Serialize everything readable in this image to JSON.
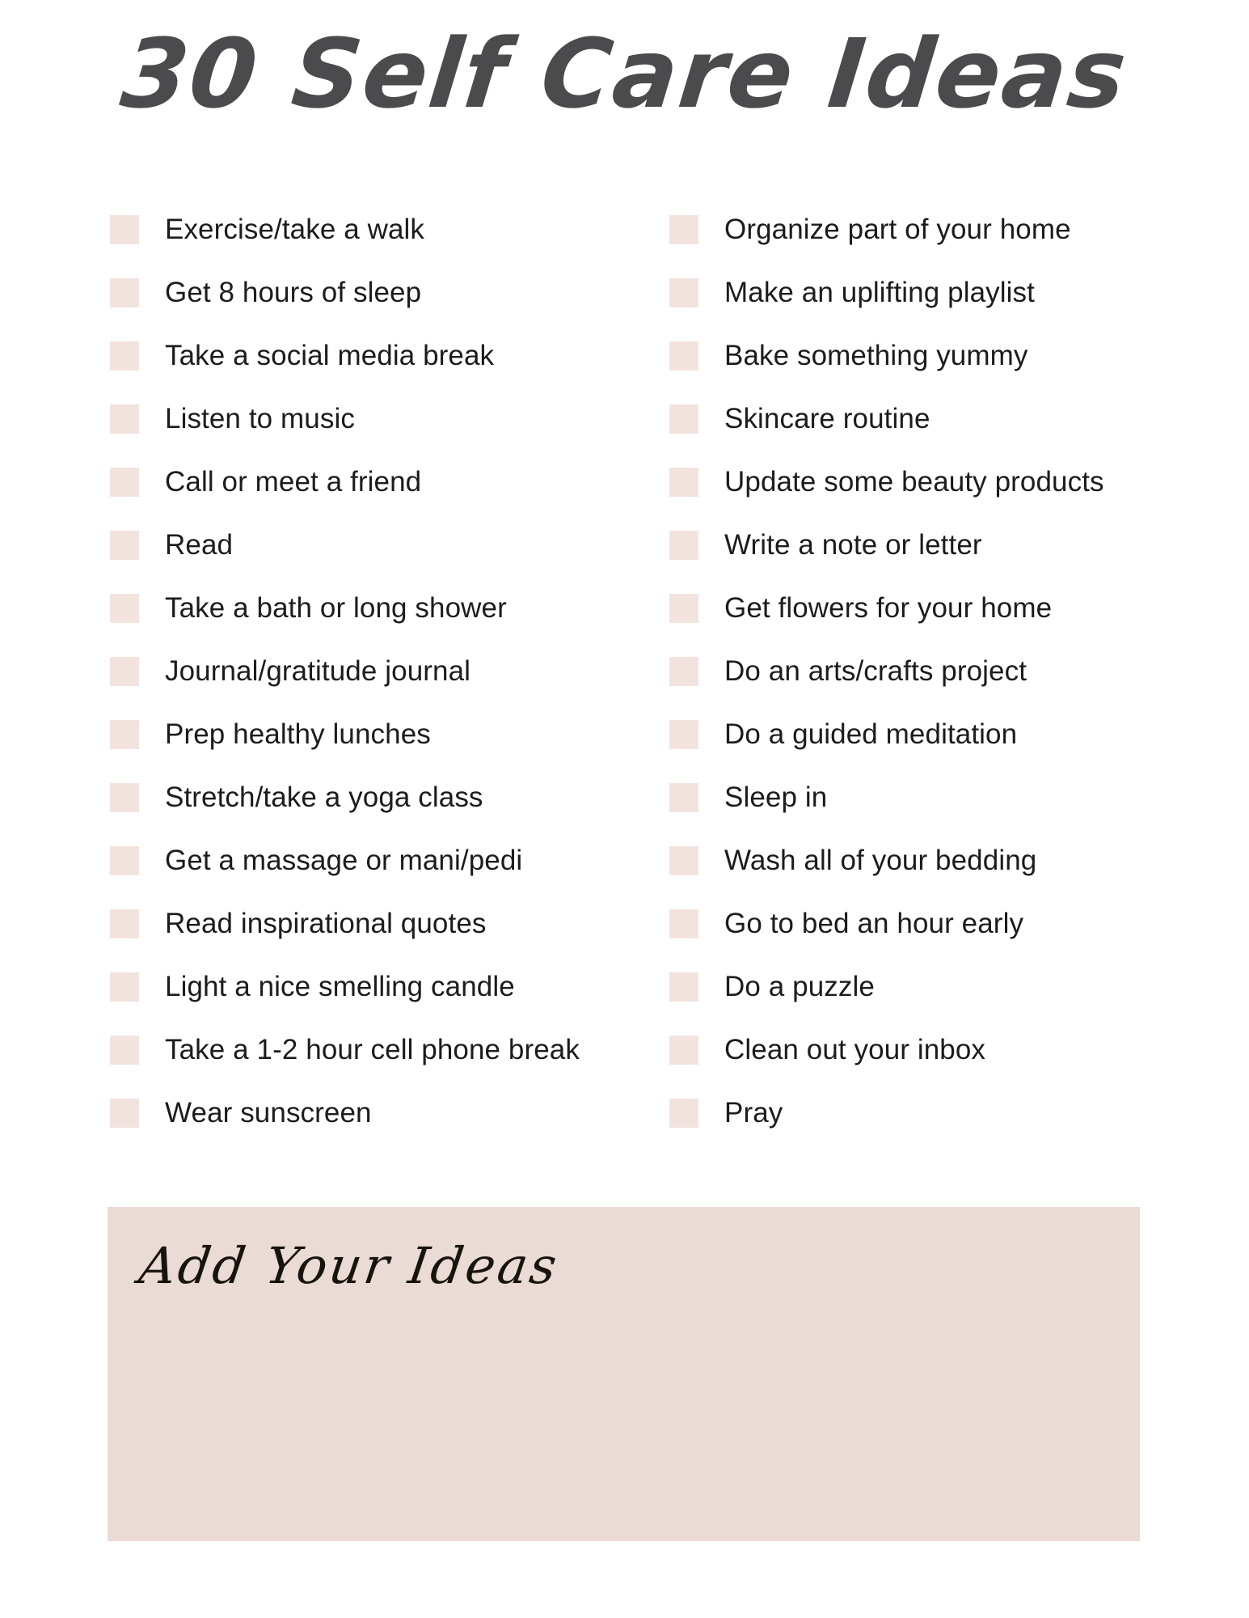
{
  "page": {
    "title": "30 Self Care Ideas",
    "background_color": "#ffffff",
    "title_color": "#4b4b4d",
    "checkbox_color": "#f3e3de",
    "text_color": "#1c1c1c",
    "accent_box_color": "#ebdbd5"
  },
  "checklist": {
    "left_column": [
      {
        "label": "Exercise/take a walk"
      },
      {
        "label": "Get 8 hours of sleep"
      },
      {
        "label": "Take a social media break"
      },
      {
        "label": "Listen to music"
      },
      {
        "label": "Call or meet a friend"
      },
      {
        "label": "Read"
      },
      {
        "label": "Take a bath or long shower"
      },
      {
        "label": "Journal/gratitude journal"
      },
      {
        "label": "Prep healthy lunches"
      },
      {
        "label": "Stretch/take a yoga class"
      },
      {
        "label": "Get a massage or mani/pedi"
      },
      {
        "label": "Read inspirational quotes"
      },
      {
        "label": "Light a nice smelling candle"
      },
      {
        "label": "Take a 1-2 hour cell phone break"
      },
      {
        "label": "Wear sunscreen"
      }
    ],
    "right_column": [
      {
        "label": "Organize part of your home"
      },
      {
        "label": "Make an uplifting playlist"
      },
      {
        "label": "Bake something yummy"
      },
      {
        "label": "Skincare routine"
      },
      {
        "label": "Update some beauty products"
      },
      {
        "label": "Write a note or letter"
      },
      {
        "label": "Get flowers for your home"
      },
      {
        "label": "Do an arts/crafts project"
      },
      {
        "label": "Do a guided meditation"
      },
      {
        "label": "Sleep in"
      },
      {
        "label": "Wash all of your bedding"
      },
      {
        "label": "Go to bed an hour early"
      },
      {
        "label": "Do a puzzle"
      },
      {
        "label": "Clean out your inbox"
      },
      {
        "label": "Pray"
      }
    ]
  },
  "ideas_section": {
    "heading": "Add Your Ideas"
  }
}
